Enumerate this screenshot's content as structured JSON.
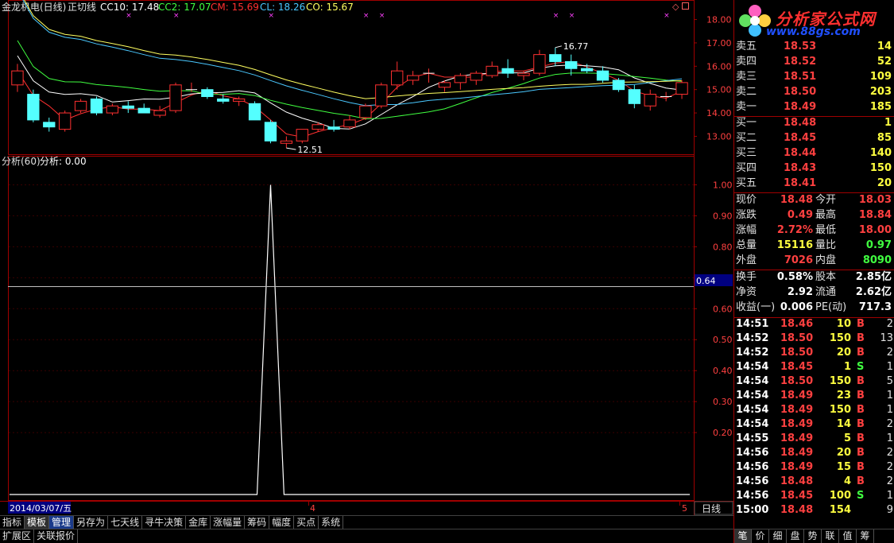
{
  "header": {
    "stock_name": "金龙机电(日线)",
    "indicator_name": "正切线",
    "cc10_label": "CC10: 17.48",
    "cc2_label": "CC2: 17.07",
    "cm_label": "CM: 15.69",
    "cl_label": "CL: 18.26",
    "co_label": "CO: 15.67"
  },
  "main_chart": {
    "y_ticks": [
      "18.00",
      "17.00",
      "16.00",
      "15.00",
      "14.00",
      "13.00"
    ],
    "y_tick_values": [
      18,
      17,
      16,
      15,
      14,
      13
    ],
    "high_annotation": "16.77",
    "low_annotation": "12.51",
    "colors": {
      "up": "#ff3030",
      "down": "#54ffff",
      "ma1": "#ffffff",
      "ma2": "#ffff60",
      "ma3": "#ff3030",
      "ma4": "#40ff40",
      "ma5": "#4ac8ff"
    }
  },
  "sub_chart": {
    "title": "分析(60)",
    "value_label": "分析: 0.00",
    "y_ticks": [
      "1.00",
      "0.90",
      "0.80",
      "0.70",
      "0.60",
      "0.50",
      "0.40",
      "0.30",
      "0.20"
    ],
    "crosshair_value": "0.64",
    "spike_value": 1.0
  },
  "x_axis": {
    "date_label": "2014/03/07/五",
    "mid_label": "4",
    "right_label": "5",
    "period_label": "日线"
  },
  "zoom": {
    "plus": "+",
    "minus": "-",
    "zero": "0"
  },
  "toolbar": [
    "指标",
    "模板",
    "管理",
    "另存为",
    "七天线",
    "寻牛决策",
    "金库",
    "涨幅量",
    "筹码",
    "幅度",
    "买点",
    "系统"
  ],
  "statusbar": [
    "扩展区",
    "关联报价"
  ],
  "logo": {
    "brand": "分析家公式网",
    "url": "www.88gs.com"
  },
  "order_book": {
    "asks": [
      {
        "label": "卖五",
        "price": "18.53",
        "vol": "14"
      },
      {
        "label": "卖四",
        "price": "18.52",
        "vol": "52"
      },
      {
        "label": "卖三",
        "price": "18.51",
        "vol": "109"
      },
      {
        "label": "卖二",
        "price": "18.50",
        "vol": "203"
      },
      {
        "label": "卖一",
        "price": "18.49",
        "vol": "185"
      }
    ],
    "bids": [
      {
        "label": "买一",
        "price": "18.48",
        "vol": "1"
      },
      {
        "label": "买二",
        "price": "18.45",
        "vol": "85"
      },
      {
        "label": "买三",
        "price": "18.44",
        "vol": "140"
      },
      {
        "label": "买四",
        "price": "18.43",
        "vol": "150"
      },
      {
        "label": "买五",
        "price": "18.41",
        "vol": "20"
      }
    ]
  },
  "quote": {
    "rows": [
      {
        "l1": "现价",
        "v1": "18.48",
        "c1": "red",
        "l2": "今开",
        "v2": "18.03",
        "c2": "red"
      },
      {
        "l1": "涨跌",
        "v1": "0.49",
        "c1": "red",
        "l2": "最高",
        "v2": "18.84",
        "c2": "red"
      },
      {
        "l1": "涨幅",
        "v1": "2.72%",
        "c1": "red",
        "l2": "最低",
        "v2": "18.00",
        "c2": "red"
      },
      {
        "l1": "总量",
        "v1": "15116",
        "c1": "yellow",
        "l2": "量比",
        "v2": "0.97",
        "c2": "green"
      },
      {
        "l1": "外盘",
        "v1": "7026",
        "c1": "red",
        "l2": "内盘",
        "v2": "8090",
        "c2": "green"
      }
    ],
    "fundamentals": [
      {
        "l1": "换手",
        "v1": "0.58%",
        "l2": "股本",
        "v2": "2.85亿"
      },
      {
        "l1": "净资",
        "v1": "2.92",
        "l2": "流通",
        "v2": "2.62亿"
      },
      {
        "l1": "收益(一)",
        "v1": "0.006",
        "l2": "PE(动)",
        "v2": "717.3"
      }
    ]
  },
  "ticks": [
    {
      "time": "14:51",
      "price": "18.46",
      "vol": "10",
      "dir": "B",
      "n": "2"
    },
    {
      "time": "14:52",
      "price": "18.50",
      "vol": "150",
      "dir": "B",
      "n": "13"
    },
    {
      "time": "14:52",
      "price": "18.50",
      "vol": "20",
      "dir": "B",
      "n": "2"
    },
    {
      "time": "14:54",
      "price": "18.45",
      "vol": "1",
      "dir": "S",
      "n": "1"
    },
    {
      "time": "14:54",
      "price": "18.50",
      "vol": "150",
      "dir": "B",
      "n": "5"
    },
    {
      "time": "14:54",
      "price": "18.49",
      "vol": "23",
      "dir": "B",
      "n": "1"
    },
    {
      "time": "14:54",
      "price": "18.49",
      "vol": "150",
      "dir": "B",
      "n": "1"
    },
    {
      "time": "14:54",
      "price": "18.49",
      "vol": "14",
      "dir": "B",
      "n": "2"
    },
    {
      "time": "14:55",
      "price": "18.49",
      "vol": "5",
      "dir": "B",
      "n": "1"
    },
    {
      "time": "14:56",
      "price": "18.49",
      "vol": "20",
      "dir": "B",
      "n": "2"
    },
    {
      "time": "14:56",
      "price": "18.49",
      "vol": "15",
      "dir": "B",
      "n": "2"
    },
    {
      "time": "14:56",
      "price": "18.48",
      "vol": "4",
      "dir": "B",
      "n": "2"
    },
    {
      "time": "14:56",
      "price": "18.45",
      "vol": "100",
      "dir": "S",
      "n": "1"
    },
    {
      "time": "15:00",
      "price": "18.48",
      "vol": "154",
      "dir": "",
      "n": "9"
    }
  ],
  "panel_tabs": [
    "笔",
    "价",
    "细",
    "盘",
    "势",
    "联",
    "值",
    "筹"
  ],
  "chart_data": {
    "type": "candlestick",
    "candles": [
      [
        15.2,
        16.1,
        14.9,
        15.8
      ],
      [
        14.8,
        15.0,
        13.6,
        13.7
      ],
      [
        13.6,
        13.8,
        13.2,
        13.4
      ],
      [
        13.3,
        14.1,
        13.2,
        14.0
      ],
      [
        14.1,
        14.6,
        14.0,
        14.5
      ],
      [
        14.6,
        14.7,
        13.9,
        14.0
      ],
      [
        14.0,
        14.4,
        13.9,
        14.3
      ],
      [
        14.3,
        14.5,
        14.0,
        14.2
      ],
      [
        14.2,
        14.4,
        14.1,
        14.0
      ],
      [
        13.9,
        14.3,
        13.8,
        14.1
      ],
      [
        14.1,
        15.3,
        14.0,
        15.2
      ],
      [
        15.0,
        15.3,
        14.9,
        15.0
      ],
      [
        15.0,
        15.1,
        14.6,
        14.7
      ],
      [
        14.6,
        14.8,
        14.4,
        14.5
      ],
      [
        14.5,
        14.7,
        14.3,
        14.6
      ],
      [
        14.4,
        14.5,
        13.7,
        13.7
      ],
      [
        13.6,
        13.7,
        12.7,
        12.8
      ],
      [
        12.7,
        13.0,
        12.5,
        12.8
      ],
      [
        12.8,
        13.3,
        12.7,
        13.3
      ],
      [
        13.3,
        13.6,
        13.2,
        13.5
      ],
      [
        13.4,
        13.7,
        13.2,
        13.3
      ],
      [
        13.4,
        13.9,
        13.3,
        13.7
      ],
      [
        13.8,
        14.4,
        13.7,
        14.3
      ],
      [
        14.3,
        15.3,
        14.2,
        15.2
      ],
      [
        15.2,
        16.2,
        15.0,
        15.8
      ],
      [
        15.4,
        15.8,
        15.2,
        15.6
      ],
      [
        15.7,
        15.9,
        15.3,
        15.7
      ],
      [
        15.1,
        15.4,
        14.9,
        15.3
      ],
      [
        15.3,
        15.7,
        15.0,
        15.6
      ],
      [
        15.4,
        15.8,
        15.2,
        15.7
      ],
      [
        15.6,
        16.2,
        15.5,
        16.0
      ],
      [
        15.9,
        16.3,
        15.5,
        15.7
      ],
      [
        15.6,
        15.8,
        15.4,
        15.7
      ],
      [
        15.7,
        16.7,
        15.6,
        16.5
      ],
      [
        16.5,
        16.8,
        16.0,
        16.2
      ],
      [
        16.2,
        16.5,
        15.6,
        15.9
      ],
      [
        15.9,
        16.1,
        15.7,
        15.8
      ],
      [
        15.8,
        16.0,
        15.3,
        15.4
      ],
      [
        15.4,
        15.5,
        14.9,
        15.0
      ],
      [
        15.0,
        15.2,
        14.2,
        14.4
      ],
      [
        14.3,
        15.0,
        14.1,
        14.8
      ],
      [
        14.7,
        14.9,
        14.5,
        14.7
      ],
      [
        14.8,
        15.4,
        14.6,
        15.3
      ]
    ],
    "ylim": [
      12.3,
      18.7
    ],
    "sub_series": {
      "spike_index": 16,
      "spike_value": 1.0,
      "baseline": 0.0,
      "ylim": [
        0.0,
        1.05
      ]
    }
  }
}
